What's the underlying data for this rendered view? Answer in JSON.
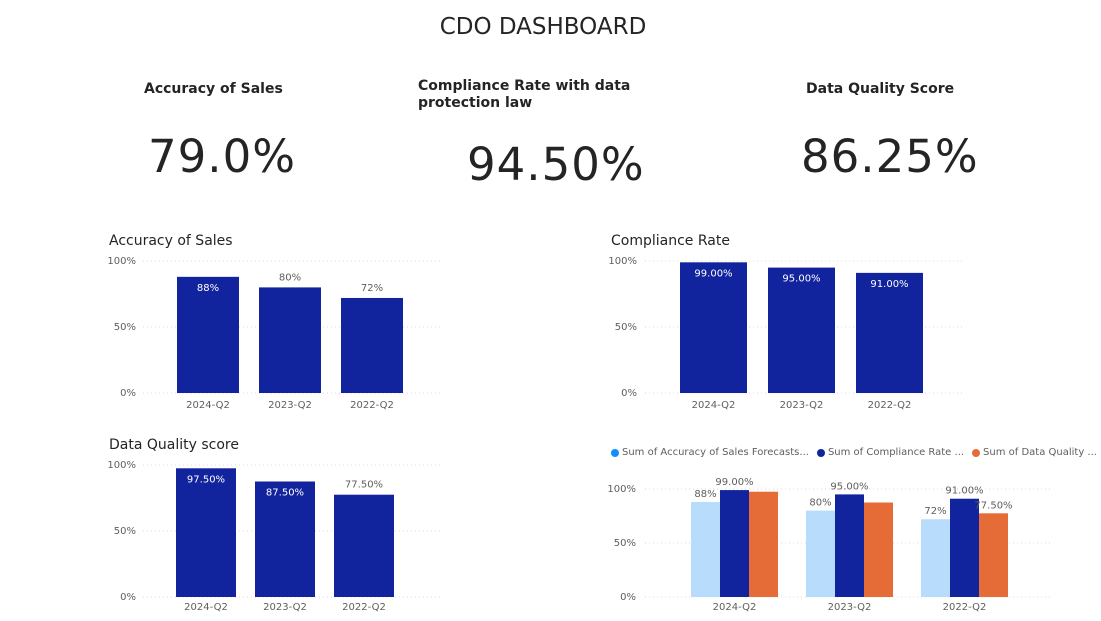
{
  "dashboard": {
    "title": "CDO DASHBOARD"
  },
  "cards": [
    {
      "title": "Accuracy of Sales",
      "value": "79.0%"
    },
    {
      "title": "Compliance Rate with data protection law",
      "value": "94.50%"
    },
    {
      "title": "Data Quality Score",
      "value": "86.25%"
    }
  ],
  "colors": {
    "bar": "#12239E",
    "series_accuracy": "#B8DCFB",
    "series_accuracy_legend": "#118DFF",
    "series_compliance": "#12239E",
    "series_quality": "#E66C37",
    "grid": "#d9d9d9",
    "label_dark": "#605e5c"
  },
  "chart_data": [
    {
      "type": "bar",
      "title": "Accuracy of Sales",
      "categories": [
        "2024-Q2",
        "2023-Q2",
        "2022-Q2"
      ],
      "values": [
        88,
        80,
        72
      ],
      "data_labels": [
        "88%",
        "80%",
        "72%"
      ],
      "yticks": [
        "0%",
        "50%",
        "100%"
      ],
      "ylim": [
        0,
        100
      ]
    },
    {
      "type": "bar",
      "title": "Compliance Rate",
      "categories": [
        "2024-Q2",
        "2023-Q2",
        "2022-Q2"
      ],
      "values": [
        99,
        95,
        91
      ],
      "data_labels": [
        "99.00%",
        "95.00%",
        "91.00%"
      ],
      "yticks": [
        "0%",
        "50%",
        "100%"
      ],
      "ylim": [
        0,
        100
      ]
    },
    {
      "type": "bar",
      "title": "Data Quality score",
      "categories": [
        "2024-Q2",
        "2023-Q2",
        "2022-Q2"
      ],
      "values": [
        97.5,
        87.5,
        77.5
      ],
      "data_labels": [
        "97.50%",
        "87.50%",
        "77.50%"
      ],
      "yticks": [
        "0%",
        "50%",
        "100%"
      ],
      "ylim": [
        0,
        100
      ]
    },
    {
      "type": "bar",
      "title": "",
      "categories": [
        "2024-Q2",
        "2023-Q2",
        "2022-Q2"
      ],
      "series": [
        {
          "name": "Sum of Accuracy of Sales Forecasts...",
          "values": [
            88,
            80,
            72
          ],
          "data_labels": [
            "88%",
            "80%",
            "72%"
          ]
        },
        {
          "name": "Sum of Compliance Rate ...",
          "values": [
            99,
            95,
            91
          ],
          "data_labels": [
            "99.00%",
            "95.00%",
            "91.00%"
          ]
        },
        {
          "name": "Sum of Data Quality ...",
          "values": [
            97.5,
            87.5,
            77.5
          ],
          "data_labels": [
            "",
            "",
            "77.50%"
          ]
        }
      ],
      "yticks": [
        "0%",
        "50%",
        "100%"
      ],
      "ylim": [
        0,
        100
      ],
      "legend": "top-left"
    }
  ]
}
